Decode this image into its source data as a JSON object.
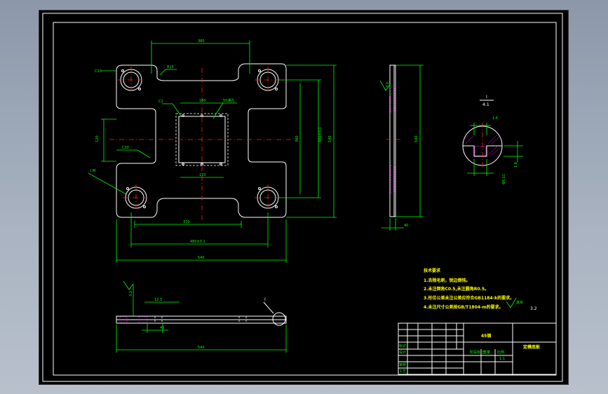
{
  "colors": {
    "background": "#000000",
    "outline": "#ffffff",
    "dimension": "#00ff00",
    "centerline": "#ff2020",
    "note_text": "#ffff00",
    "desktop": "#9aa6b6"
  },
  "plan_view": {
    "dims": {
      "top_width": "380",
      "hole_pitch": "480±0.1",
      "bottom_width": "540",
      "bottom_inner": "370",
      "left_height": "120",
      "window_top": "180",
      "window_bottom": "120",
      "right_inner": "380",
      "right_pitch": "480±0.1",
      "right_overall": "540"
    },
    "callouts": {
      "corner_r": "C10",
      "top_r": "R15",
      "window_c": "C2",
      "window_label": "50通孔",
      "side_c": "C20",
      "hole_label": "I M"
    }
  },
  "section_view": {
    "dims": {
      "height": "540",
      "thickness": "40"
    },
    "callout": "3.2"
  },
  "detail_view": {
    "label": "I",
    "scale": "4:1",
    "dim_a": "1.6",
    "dim_b": "1.6",
    "dim_c": "Φ5.11"
  },
  "side_view": {
    "dims": {
      "overall": "540",
      "depth": "12.5",
      "slot": "40"
    },
    "callout": "I",
    "roughness": "3.2"
  },
  "notes": {
    "title": "技术要求",
    "items": [
      "1.去除毛刺，锐边倒钝。",
      "2.未注倒角C0.5,未注圆角R0.5。",
      "3.形位公差未注公差应符合GB1184-k的要求。",
      "4.未注尺寸公差按GB/T1804-m的要求。"
    ],
    "roughness_label": "其余",
    "roughness_value": "3.2"
  },
  "title_block": {
    "material": "45钢",
    "drawing_name": "定模底板",
    "scale": "1:1",
    "rows": [
      "标记",
      "设计",
      "审核",
      "工艺"
    ],
    "mid_labels": [
      "阶段标记",
      "重量",
      "比例"
    ]
  }
}
